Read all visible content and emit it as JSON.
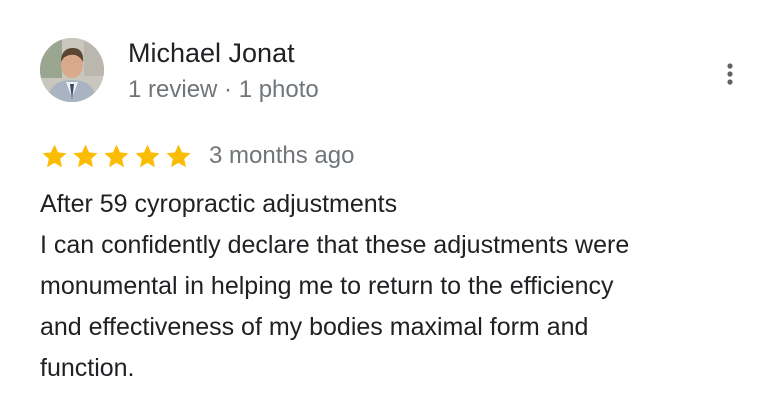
{
  "reviewer": {
    "name": "Michael Jonat",
    "meta": "1 review · 1 photo"
  },
  "rating": {
    "stars": 5,
    "max": 5,
    "star_color": "#fbbc04",
    "date": "3 months ago"
  },
  "review": {
    "lines": [
      "After 59 cyropractic adjustments",
      "I can confidently declare that these adjustments were",
      "monumental in helping me to return to the efficiency",
      "and effectiveness of my bodies maximal form and",
      "function."
    ]
  },
  "icons": {
    "more": "more-vert-icon",
    "star": "star-icon"
  },
  "colors": {
    "text_primary": "#202124",
    "text_secondary": "#70757a",
    "icon": "#5f6368"
  }
}
